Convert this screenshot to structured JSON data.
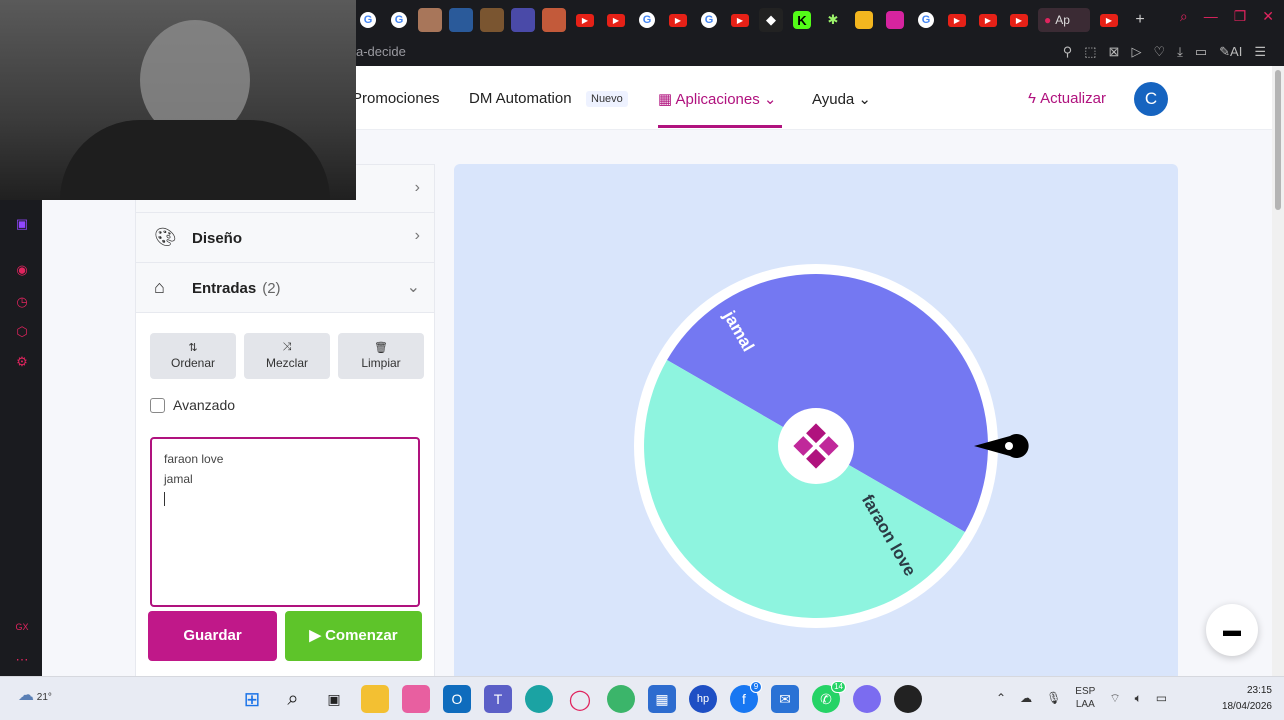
{
  "browser": {
    "url": "a-decide",
    "active_tab_label": "Ap",
    "tabs": [
      "G",
      "G",
      "img",
      "img",
      "img",
      "img",
      "img",
      "yt",
      "yt",
      "G",
      "yt",
      "G",
      "yt",
      "img",
      "K",
      "img",
      "img",
      "img",
      "G",
      "yt",
      "yt",
      "yt",
      "active",
      "yt",
      "+"
    ]
  },
  "nav": {
    "promociones": "Promociones",
    "dm_automation": "DM Automation",
    "nuevo": "Nuevo",
    "aplicaciones": "Aplicaciones",
    "ayuda": "Ayuda",
    "actualizar": "Actualizar",
    "avatar_letter": "C"
  },
  "panel": {
    "diseno": "Diseño",
    "entradas": "Entradas",
    "entradas_count": "(2)",
    "ordenar": "Ordenar",
    "mezclar": "Mezclar",
    "limpiar": "Limpiar",
    "avanzado": "Avanzado",
    "entries": [
      "faraon love",
      "jamal"
    ],
    "guardar": "Guardar",
    "comenzar": "Comenzar"
  },
  "wheel": {
    "segments": [
      {
        "label": "jamal",
        "color": "#7478f2",
        "share": 0.5
      },
      {
        "label": "faraon love",
        "color": "#8ef4df",
        "share": 0.5
      }
    ],
    "center_color": "#b0127e"
  },
  "taskbar": {
    "temperature": "21°",
    "lang_1": "ESP",
    "lang_2": "LAA",
    "time": "23:15",
    "date": "18/04/2026",
    "badge_facebook": "9",
    "badge_whatsapp": "14"
  },
  "colors": {
    "brand": "#b0127e",
    "guardar": "#c01889",
    "comenzar": "#5ec42a",
    "wheel_bg": "#d9e5fb"
  }
}
